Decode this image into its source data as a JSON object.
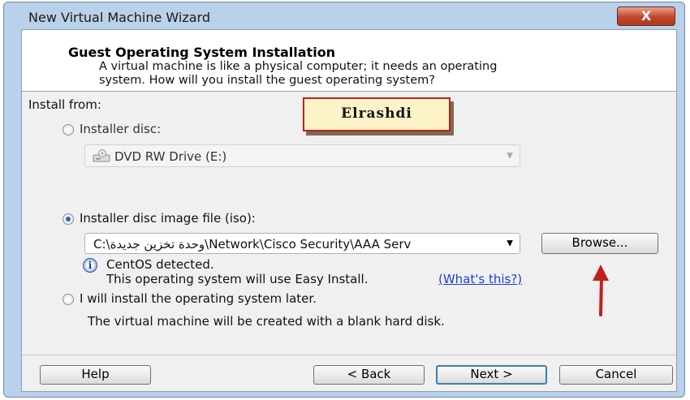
{
  "window": {
    "title": "New Virtual Machine Wizard",
    "close_label": "X"
  },
  "header": {
    "title": "Guest Operating System Installation",
    "description_line1": "A virtual machine is like a physical computer; it needs an operating",
    "description_line2": "system. How will you install the guest operating system?"
  },
  "install_from": {
    "label": "Install from:",
    "option_disc": {
      "label": "Installer disc:",
      "selected": false,
      "drive_value": "DVD RW Drive (E:)"
    },
    "option_iso": {
      "label": "Installer disc image file (iso):",
      "selected": true,
      "path_value": "C:\\وحدة تخزين جديدة\\Network\\Cisco Security\\AAA Serv",
      "browse_label": "Browse..."
    },
    "detection": {
      "line1": "CentOS detected.",
      "line2": "This operating system will use Easy Install.",
      "link": "(What's this?)"
    },
    "option_later": {
      "label": "I will install the operating system later.",
      "selected": false,
      "description": "The virtual machine will be created with a blank hard disk."
    }
  },
  "overlay": {
    "text": "Elrashdi"
  },
  "footer": {
    "help_label": "Help",
    "back_label": "< Back",
    "next_label": "Next >",
    "cancel_label": "Cancel"
  },
  "colors": {
    "link": "#1d3fd6",
    "annotation_arrow": "#c0201a",
    "window_frame": "#b9d1ea"
  }
}
